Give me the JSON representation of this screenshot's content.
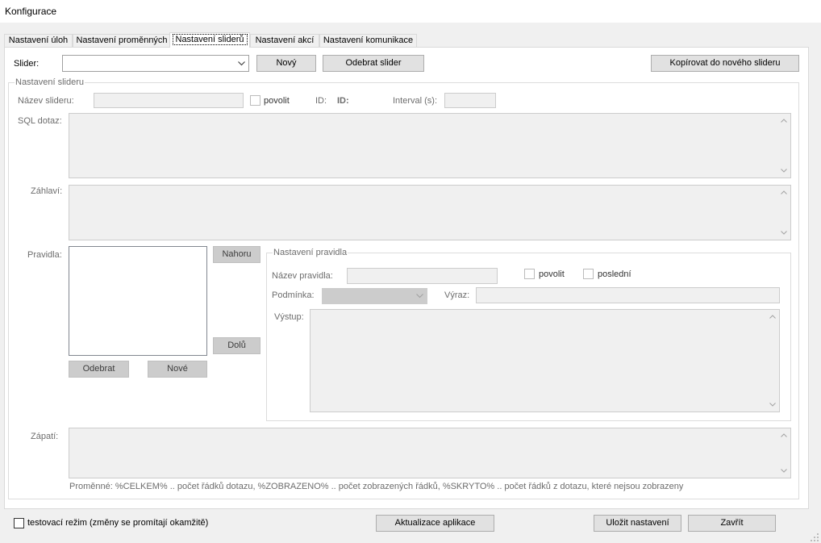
{
  "window": {
    "title": "Konfigurace"
  },
  "tabs": [
    {
      "label": "Nastavení úloh",
      "selected": false
    },
    {
      "label": "Nastavení proměnných",
      "selected": false
    },
    {
      "label": "Nastavení sliderů",
      "selected": true
    },
    {
      "label": "Nastavení akcí",
      "selected": false
    },
    {
      "label": "Nastavení komunikace",
      "selected": false
    }
  ],
  "slider_toolbar": {
    "slider_label": "Slider:",
    "slider_selected": "",
    "new_button": "Nový",
    "remove_button": "Odebrat slider",
    "copy_button": "Kopírovat do nového slideru"
  },
  "slider_settings": {
    "legend": "Nastavení slideru",
    "name": {
      "label": "Název slideru:",
      "value": ""
    },
    "enable_checkbox": {
      "label": "povolit",
      "checked": false
    },
    "id": {
      "label": "ID:",
      "value": "ID:"
    },
    "interval": {
      "label": "Interval (s):",
      "value": ""
    },
    "sql_query": {
      "label": "SQL dotaz:",
      "value": ""
    },
    "header": {
      "label": "Záhlaví:",
      "value": ""
    },
    "rules": {
      "label": "Pravidla:",
      "items": [],
      "up_button": "Nahoru",
      "down_button": "Dolů",
      "remove_button": "Odebrat",
      "new_button": "Nové"
    },
    "footer": {
      "label": "Zápatí:",
      "value": ""
    },
    "variables_hint": "Proměnné: %CELKEM% .. počet řádků dotazu, %ZOBRAZENO% .. počet zobrazených řádků, %SKRYTO% .. počet řádků z dotazu, které nejsou zobrazeny"
  },
  "rule_settings": {
    "legend": "Nastavení pravidla",
    "name": {
      "label": "Název pravidla:",
      "value": ""
    },
    "enable_checkbox": {
      "label": "povolit",
      "checked": false
    },
    "last_checkbox": {
      "label": "poslední",
      "checked": false
    },
    "condition": {
      "label": "Podmínka:",
      "selected": ""
    },
    "expression": {
      "label": "Výraz:",
      "value": ""
    },
    "output": {
      "label": "Výstup:",
      "value": ""
    }
  },
  "bottom_bar": {
    "test_mode": {
      "label": "testovací režim (změny se promítají okamžitě)",
      "checked": false
    },
    "update_button": "Aktualizace aplikace",
    "save_button": "Uložit nastavení",
    "close_button": "Zavřít"
  },
  "icons": {
    "dropdown_arrow": "chevron-down-icon",
    "scroll_up": "chevron-up-icon",
    "scroll_down": "chevron-down-icon",
    "resize_grip": "size-grip-icon"
  },
  "colors": {
    "window_bg": "#f0f0f0",
    "panel_bg": "#ffffff",
    "disabled_text": "#6d6d6d",
    "disabled_field_bg": "#f0f0f0",
    "button_bg": "#e1e1e1",
    "disabled_button_bg": "#cccccc"
  }
}
